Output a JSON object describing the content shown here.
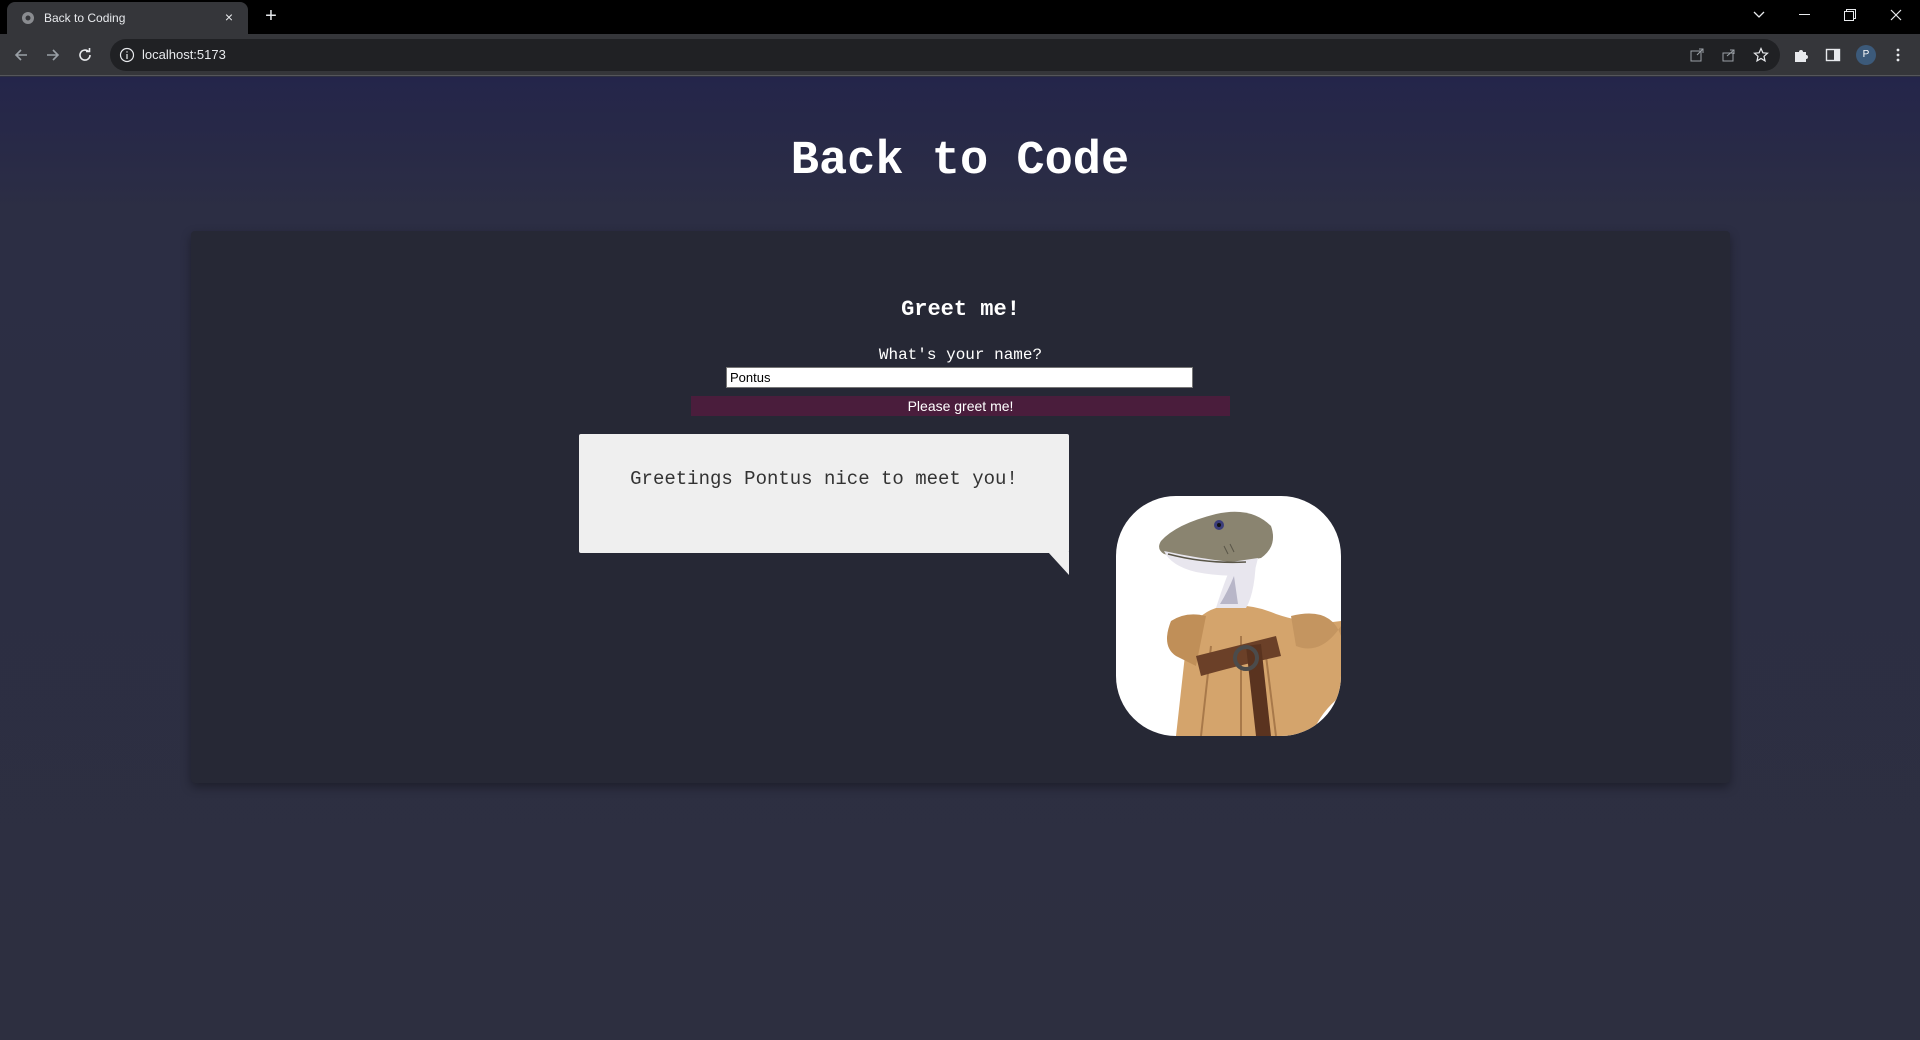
{
  "browser": {
    "tab_title": "Back to Coding",
    "tab_close_glyph": "×",
    "new_tab_glyph": "+",
    "url": "localhost:5173",
    "profile_initial": "P",
    "icons": [
      "back-arrow-icon",
      "forward-arrow-icon",
      "reload-icon",
      "info-icon",
      "open-in-app-icon",
      "share-icon",
      "bookmark-star-icon",
      "extensions-puzzle-icon",
      "side-panel-icon",
      "kebab-menu-icon",
      "tab-search-chevron-icon",
      "minimize-icon",
      "restore-icon",
      "close-window-icon"
    ]
  },
  "page": {
    "title": "Back to Code"
  },
  "greeter": {
    "heading": "Greet me!",
    "label": "What's your name?",
    "input_value": "Pontus",
    "button_label": "Please greet me!",
    "greeting": "Greetings Pontus nice to meet you!"
  },
  "colors": {
    "background": "#2d2f40",
    "card": "#262835",
    "button": "#4a1d3c",
    "bubble": "#efefef"
  }
}
